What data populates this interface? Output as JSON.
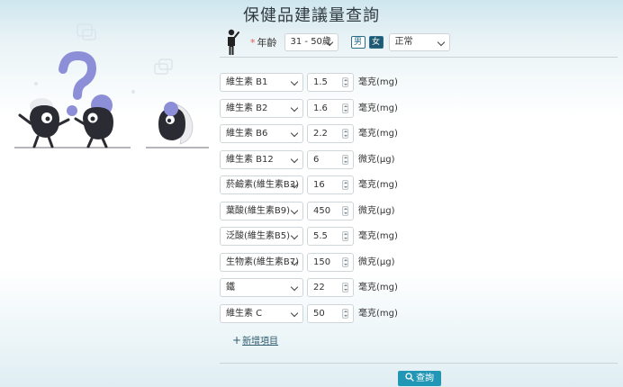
{
  "header": {
    "title": "保健品建議量查詢"
  },
  "criteria": {
    "age_label": "年齡",
    "age_value": "31 - 50歲",
    "gender_male": "男",
    "gender_female": "女",
    "status_value": "正常"
  },
  "items": [
    {
      "name": "維生素 B1",
      "amount": "1.5",
      "unit": "毫克(mg)"
    },
    {
      "name": "維生素 B2",
      "amount": "1.6",
      "unit": "毫克(mg)"
    },
    {
      "name": "維生素 B6",
      "amount": "2.2",
      "unit": "毫克(mg)"
    },
    {
      "name": "維生素 B12",
      "amount": "6",
      "unit": "微克(µg)"
    },
    {
      "name": "菸鹼素(維生素B3)",
      "amount": "16",
      "unit": "毫克(mg)"
    },
    {
      "name": "葉酸(維生素B9)",
      "amount": "450",
      "unit": "微克(µg)"
    },
    {
      "name": "泛酸(維生素B5)",
      "amount": "5.5",
      "unit": "毫克(mg)"
    },
    {
      "name": "生物素(維生素B7)",
      "amount": "150",
      "unit": "微克(µg)"
    },
    {
      "name": "鐵",
      "amount": "22",
      "unit": "毫克(mg)"
    },
    {
      "name": "維生素 C",
      "amount": "50",
      "unit": "毫克(mg)"
    }
  ],
  "actions": {
    "add_label": "新增項目",
    "query_label": "查詢"
  },
  "colors": {
    "accent": "#2196b5",
    "illustration": "#8c8fd8",
    "dark": "#2b2b33"
  }
}
